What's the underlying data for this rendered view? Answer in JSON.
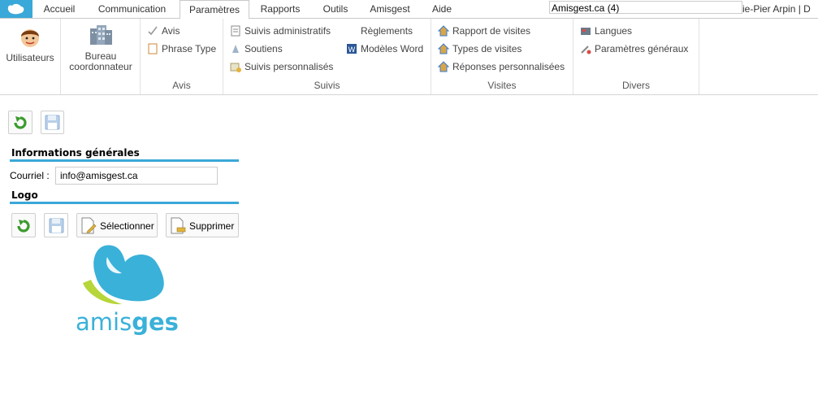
{
  "nav": {
    "tabs": [
      {
        "label": "Accueil"
      },
      {
        "label": "Communication"
      },
      {
        "label": "Paramètres"
      },
      {
        "label": "Rapports"
      },
      {
        "label": "Outils"
      },
      {
        "label": "Amisgest"
      },
      {
        "label": "Aide"
      }
    ],
    "search_value": "Amisgest.ca (4)",
    "user_text": "ie-Pier Arpin | D"
  },
  "ribbon": {
    "utilisateurs": "Utilisateurs",
    "bureau": "Bureau coordonnateur",
    "avis_group": {
      "label": "Avis",
      "items": [
        "Avis",
        "Phrase Type"
      ]
    },
    "suivis_group": {
      "label": "Suivis",
      "items": [
        "Suivis administratifs",
        "Soutiens",
        "Suivis personnalisés",
        "Règlements",
        "Modèles Word"
      ]
    },
    "visites_group": {
      "label": "Visites",
      "items": [
        "Rapport de visites",
        "Types de visites",
        "Réponses personnalisées"
      ]
    },
    "divers_group": {
      "label": "Divers",
      "items": [
        "Langues",
        "Paramètres généraux"
      ]
    }
  },
  "main": {
    "info_title": "Informations générales",
    "courriel_label": "Courriel :",
    "courriel_value": "info@amisgest.ca",
    "logo_title": "Logo",
    "select_label": "Sélectionner",
    "delete_label": "Supprimer",
    "brand_text_a": "amis",
    "brand_text_b": "gest"
  },
  "colors": {
    "accent": "#3aa8d8",
    "green": "#3c9b2e",
    "logo_lime": "#b7d63a"
  }
}
